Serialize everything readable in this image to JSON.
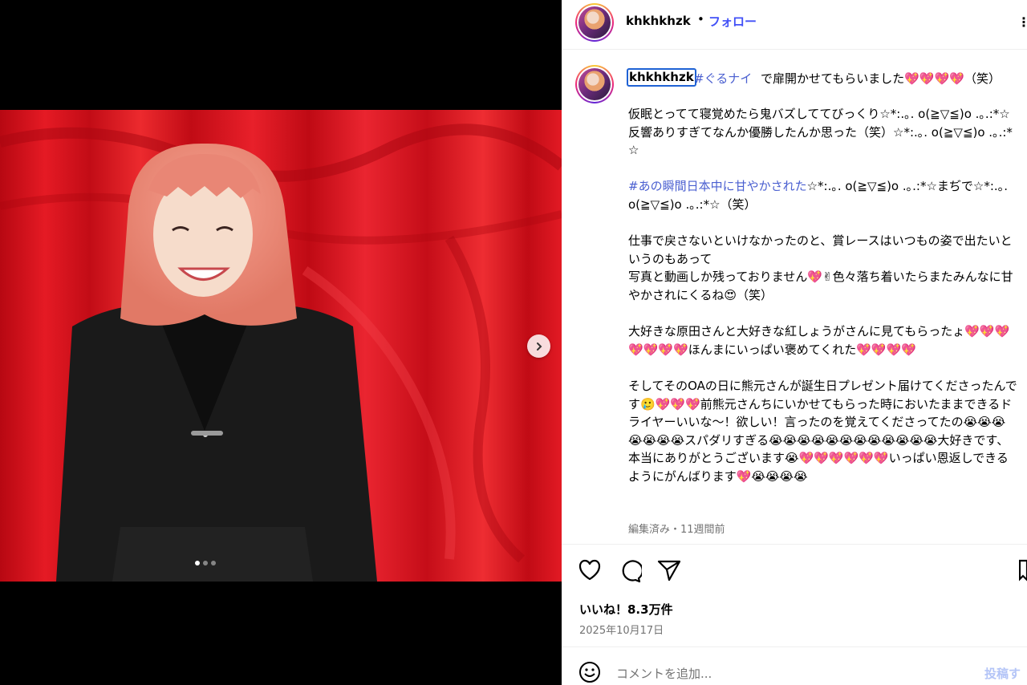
{
  "post": {
    "username": "khkhkhzk",
    "separator": "•",
    "follow_label": "フォロー",
    "more_icon": "more-dots-icon"
  },
  "caption": {
    "username": "khkhkhzk",
    "hashtag_1": "#ぐるナイ",
    "first_line": " で扉開かせてもらいました💖💖💖💖（笑）",
    "para_1": "仮眠とってて寝覚めたら鬼バズしててびっくり☆*:.｡. o(≧▽≦)o .｡.:*☆\n反響ありすぎてなんか優勝したんか思った（笑）☆*:.｡. o(≧▽≦)o .｡.:*☆",
    "hashtag_2": "#あの瞬間日本中に甘やかされた",
    "para_2": "☆*:.｡. o(≧▽≦)o .｡.:*☆まぢで☆*:.｡. o(≧▽≦)o .｡.:*☆（笑）",
    "para_3": "仕事で戻さないといけなかったのと、賞レースはいつもの姿で出たいというのもあって\n写真と動画しか残っておりません💖✌色々落ち着いたらまたみんなに甘やかされにくるね😍（笑）",
    "para_4": "大好きな原田さんと大好きな紅しょうがさんに見てもらったょ💖💖💖💖💖💖💖ほんまにいっぱい褒めてくれた💖💖💖💖",
    "para_5": "そしてそのOAの日に熊元さんが誕生日プレゼント届けてくださったんです🥲💖💖💖前熊元さんちにいかせてもらった時においたままできるドライヤーいいな〜！欲しい！言ったのを覚えてくださってたの😭😭😭😭😭😭😭スパダリすぎる😭😭😭😭😭😭😭😭😭😭😭😭大好きです、本当にありがとうございます😭💖💖💖💖💖💖いっぱい恩返しできるようにがんばります💖😭😭😭😭",
    "meta": "編集済み・11週間前"
  },
  "actions": {
    "icons": [
      "heart-icon",
      "comment-icon",
      "share-icon",
      "bookmark-icon"
    ],
    "likes": "いいね！8.3万件",
    "date": "2025年10月17日"
  },
  "comment": {
    "placeholder": "コメントを追加...",
    "post_label": "投稿す"
  },
  "carousel": {
    "slides": 3,
    "active_index": 0
  },
  "colors": {
    "link": "#4150f7",
    "hashtag": "#4a5fd0",
    "curtain": "#d8101c",
    "post_disabled": "#b3c4f7"
  }
}
